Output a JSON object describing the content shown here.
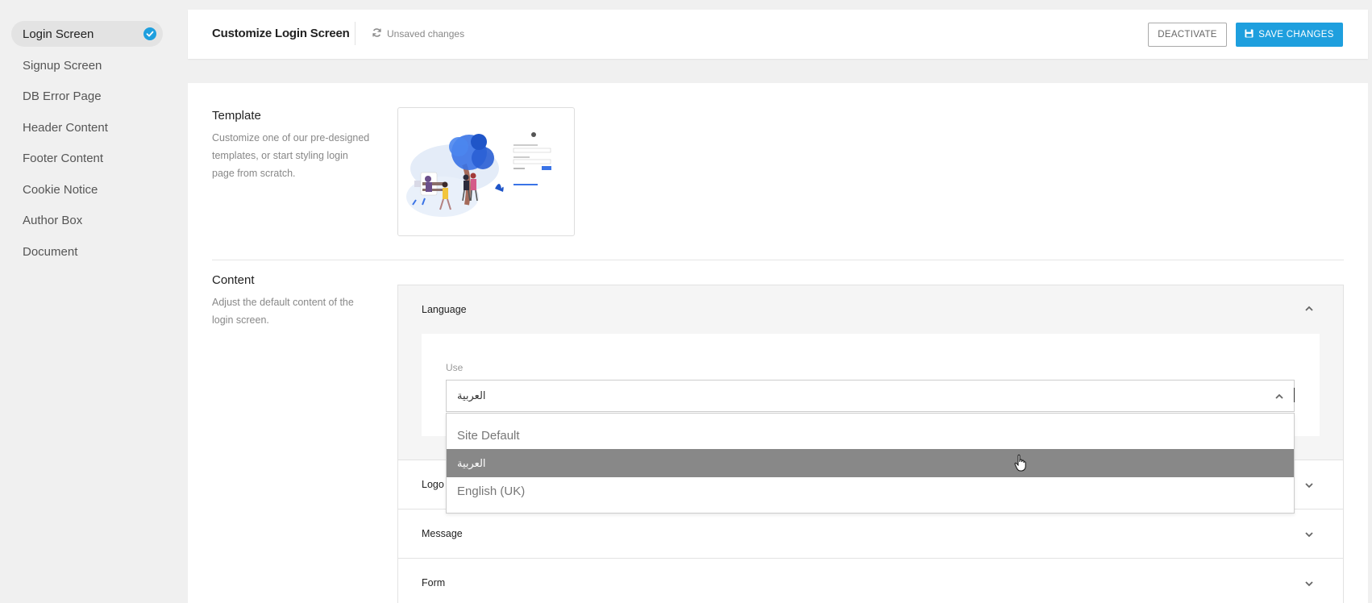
{
  "sidebar": {
    "items": [
      {
        "label": "Login Screen",
        "active": true
      },
      {
        "label": "Signup Screen"
      },
      {
        "label": "DB Error Page"
      },
      {
        "label": "Header Content"
      },
      {
        "label": "Footer Content"
      },
      {
        "label": "Cookie Notice"
      },
      {
        "label": "Author Box"
      },
      {
        "label": "Document"
      }
    ]
  },
  "header": {
    "title": "Customize Login Screen",
    "status": "Unsaved changes",
    "deactivate_label": "DEACTIVATE",
    "save_label": "SAVE CHANGES"
  },
  "template_section": {
    "title": "Template",
    "description": "Customize one of our pre-designed templates, or start styling login page from scratch."
  },
  "content_section": {
    "title": "Content",
    "description": "Adjust the default content of the login screen.",
    "accordion": [
      {
        "label": "Language",
        "expanded": true
      },
      {
        "label": "Logo",
        "expanded": false
      },
      {
        "label": "Message",
        "expanded": false
      },
      {
        "label": "Form",
        "expanded": false
      }
    ]
  },
  "language": {
    "use_label": "Use",
    "selected_value": "العربية",
    "options": [
      "Site Default",
      "العربية",
      "English (UK)"
    ],
    "highlighted_index": 1
  },
  "colors": {
    "accent": "#1e9fde",
    "highlight": "#888888"
  }
}
